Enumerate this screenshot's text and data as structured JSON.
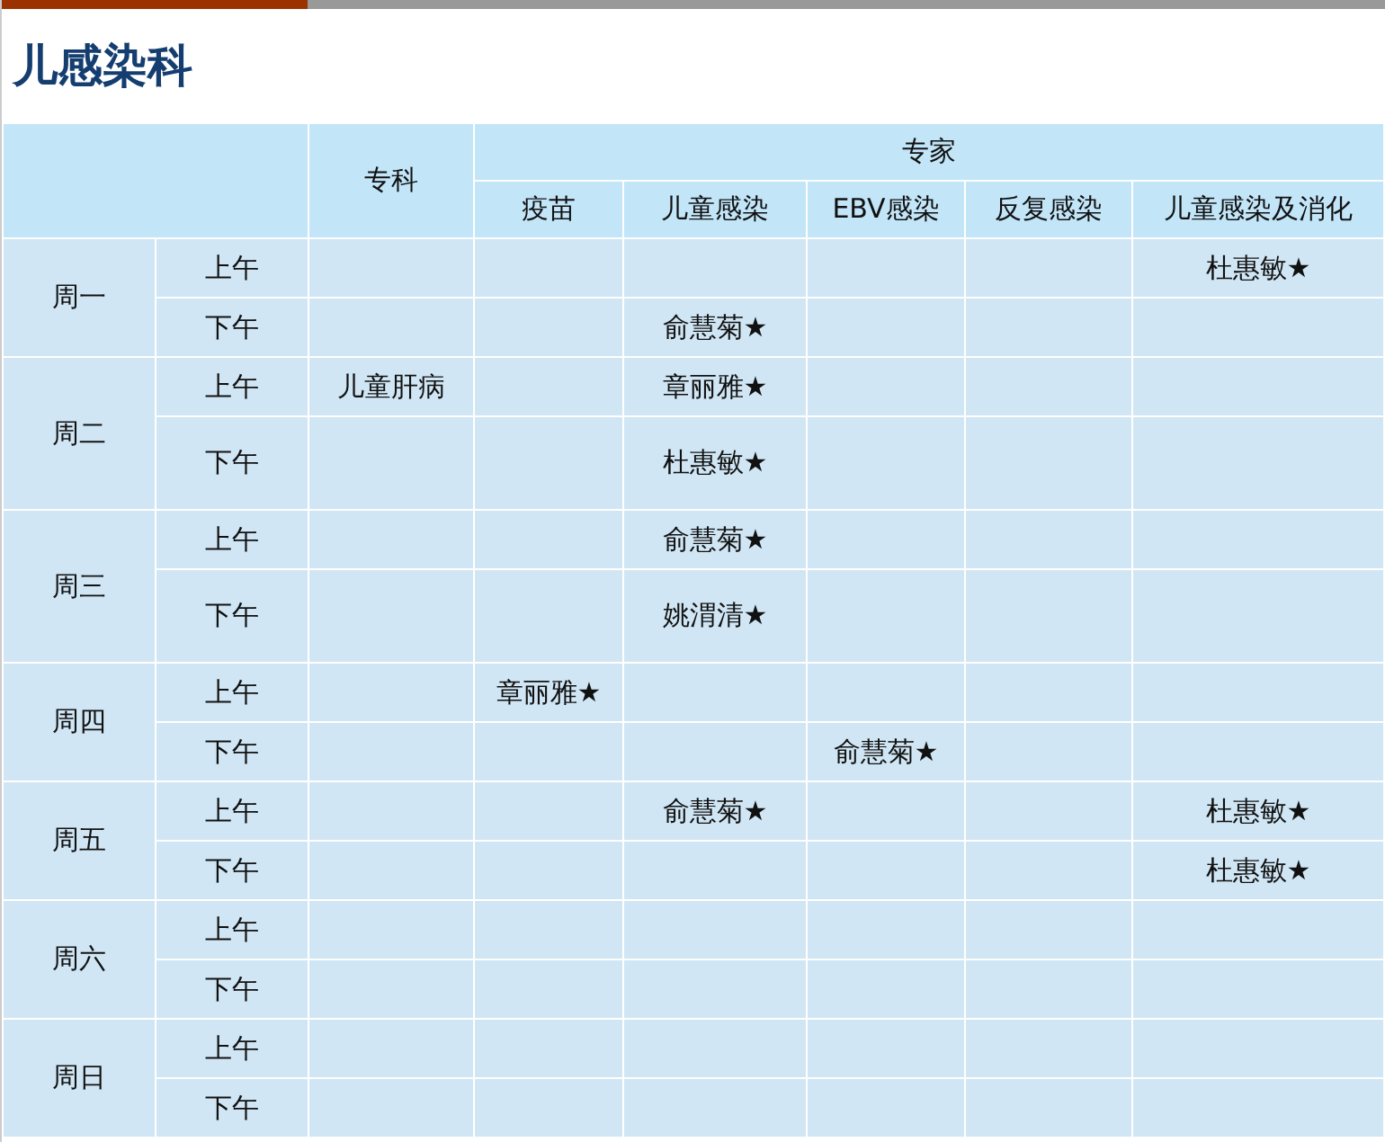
{
  "title": "儿感染科",
  "header": {
    "specialty": "专科",
    "experts": "专家",
    "expert_columns": [
      "疫苗",
      "儿童感染",
      "EBV感染",
      "反复感染",
      "儿童感染及消化"
    ]
  },
  "days": [
    {
      "label": "周一",
      "sessions": [
        {
          "label": "上午",
          "child_infection_digestive": "杜惠敏★"
        },
        {
          "label": "下午",
          "child_infection": "俞慧菊★"
        }
      ]
    },
    {
      "label": "周二",
      "sessions": [
        {
          "label": "上午",
          "specialty": "儿童肝病",
          "child_infection": "章丽雅★"
        },
        {
          "label": "下午",
          "child_infection": "杜惠敏★"
        }
      ]
    },
    {
      "label": "周三",
      "sessions": [
        {
          "label": "上午",
          "child_infection": "俞慧菊★"
        },
        {
          "label": "下午",
          "child_infection": "姚渭清★"
        }
      ]
    },
    {
      "label": "周四",
      "sessions": [
        {
          "label": "上午",
          "vaccine": "章丽雅★"
        },
        {
          "label": "下午",
          "ebv": "俞慧菊★"
        }
      ]
    },
    {
      "label": "周五",
      "sessions": [
        {
          "label": "上午",
          "child_infection": "俞慧菊★",
          "child_infection_digestive": "杜惠敏★"
        },
        {
          "label": "下午",
          "child_infection_digestive": "杜惠敏★"
        }
      ]
    },
    {
      "label": "周六",
      "sessions": [
        {
          "label": "上午"
        },
        {
          "label": "下午"
        }
      ]
    },
    {
      "label": "周日",
      "sessions": [
        {
          "label": "上午"
        },
        {
          "label": "下午"
        }
      ]
    }
  ]
}
